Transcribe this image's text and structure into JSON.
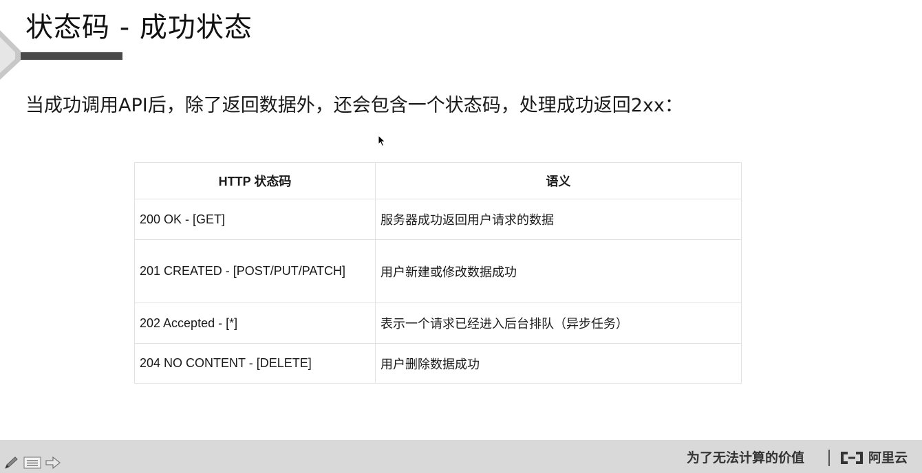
{
  "slide": {
    "title": "状态码 - 成功状态",
    "intro": "当成功调用API后，除了返回数据外，还会包含一个状态码，处理成功返回2xx："
  },
  "table": {
    "headers": [
      "HTTP 状态码",
      "语义"
    ],
    "rows": [
      {
        "code": "200 OK - [GET]",
        "meaning": "服务器成功返回用户请求的数据"
      },
      {
        "code": "201 CREATED - [POST/PUT/PATCH]",
        "meaning": "用户新建或修改数据成功"
      },
      {
        "code": "202 Accepted - [*]",
        "meaning": "表示一个请求已经进入后台排队（异步任务）"
      },
      {
        "code": "204 NO CONTENT - [DELETE]",
        "meaning": "用户删除数据成功"
      }
    ]
  },
  "footer": {
    "slogan": "为了无法计算的价值",
    "brand": "阿里云",
    "tools": [
      "pen-icon",
      "menu-icon",
      "next-arrow-icon"
    ]
  },
  "colors": {
    "title_bar": "#4a4a4a",
    "footer_bg": "#d9d9d9",
    "table_border": "#e2e2e2"
  }
}
